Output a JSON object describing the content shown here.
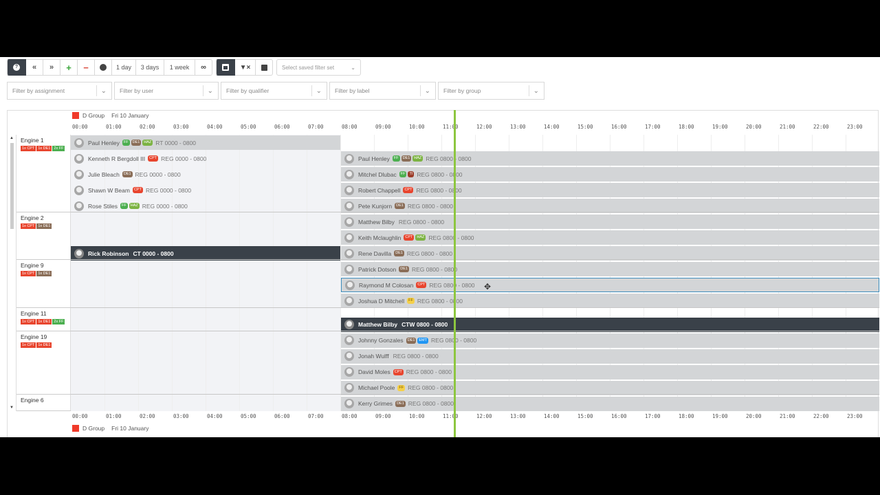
{
  "toolbar": {
    "day1": "1 day",
    "day3": "3 days",
    "week1": "1 week",
    "saved_filter_placeholder": "Select saved filter set"
  },
  "filters": [
    {
      "label": "Filter by assignment"
    },
    {
      "label": "Filter by user"
    },
    {
      "label": "Filter by qualifier"
    },
    {
      "label": "Filter by label"
    },
    {
      "label": "Filter by group"
    }
  ],
  "header": {
    "group": "D Group",
    "date": "Fri 10 January"
  },
  "hours": [
    "00:00",
    "01:00",
    "02:00",
    "03:00",
    "04:00",
    "05:00",
    "06:00",
    "07:00",
    "08:00",
    "09:00",
    "10:00",
    "11:00",
    "12:00",
    "13:00",
    "14:00",
    "15:00",
    "16:00",
    "17:00",
    "18:00",
    "19:00",
    "20:00",
    "21:00",
    "22:00",
    "23:00"
  ],
  "colors": {
    "now_line": "#8dc63f",
    "group": "#f03a2a",
    "dark_row": "#3a4149",
    "grey_row": "#d3d5d7"
  },
  "engines": [
    {
      "name": "Engine 1",
      "badges": [
        {
          "t": "1x CPT",
          "c": "#e8452e"
        },
        {
          "t": "1x DE1",
          "c": "#e8452e"
        },
        {
          "t": "2x FF",
          "c": "#4caf50"
        }
      ]
    },
    {
      "name": "Engine 2",
      "badges": [
        {
          "t": "1x CPT",
          "c": "#e8452e"
        },
        {
          "t": "1x DE1",
          "c": "#8a6d57"
        }
      ]
    },
    {
      "name": "Engine 9",
      "badges": [
        {
          "t": "1x CPT",
          "c": "#e8452e"
        },
        {
          "t": "1x DE1",
          "c": "#8a6d57"
        }
      ]
    },
    {
      "name": "Engine 11",
      "badges": [
        {
          "t": "1x CPT",
          "c": "#e8452e"
        },
        {
          "t": "1x DE1",
          "c": "#e8452e"
        },
        {
          "t": "2x FF",
          "c": "#4caf50"
        }
      ]
    },
    {
      "name": "Engine 19",
      "badges": [
        {
          "t": "1x CPT",
          "c": "#e8452e"
        },
        {
          "t": "1x DE1",
          "c": "#e8452e"
        }
      ]
    },
    {
      "name": "Engine 6",
      "badges": []
    }
  ],
  "shifts": [
    {
      "name": "Paul Henley",
      "badges": [
        {
          "t": "FF",
          "c": "#4caf50"
        },
        {
          "t": "DE1",
          "c": "#8a6d57"
        },
        {
          "t": "HAZ",
          "c": "#7cb342"
        }
      ],
      "shift": "RT 0000 - 0800",
      "side": "left",
      "kind": "grey"
    },
    {
      "name": "Kenneth R Bergdoll III",
      "badges": [
        {
          "t": "CPT",
          "c": "#e8452e"
        }
      ],
      "shift": "REG 0000 - 0800",
      "side": "left",
      "kind": "none"
    },
    {
      "name": "Julie Bleach",
      "badges": [
        {
          "t": "DE1",
          "c": "#8a6d57"
        }
      ],
      "shift": "REG 0000 - 0800",
      "side": "left",
      "kind": "none"
    },
    {
      "name": "Shawn W Beam",
      "badges": [
        {
          "t": "CPT",
          "c": "#e8452e"
        }
      ],
      "shift": "REG 0000 - 0800",
      "side": "left",
      "kind": "none"
    },
    {
      "name": "Rose Stiles",
      "badges": [
        {
          "t": "FF",
          "c": "#4caf50"
        },
        {
          "t": "HAZ",
          "c": "#7cb342"
        }
      ],
      "shift": "REG 0000 - 0800",
      "side": "left",
      "kind": "none"
    },
    {
      "name": "Paul Henley",
      "badges": [
        {
          "t": "FF",
          "c": "#4caf50"
        },
        {
          "t": "DE1",
          "c": "#8a6d57"
        },
        {
          "t": "HAZ",
          "c": "#7cb342"
        }
      ],
      "shift": "REG 0800 - 0800",
      "side": "right",
      "kind": "grey"
    },
    {
      "name": "Mitchel Dlubac",
      "badges": [
        {
          "t": "FF",
          "c": "#4caf50"
        },
        {
          "t": "TI",
          "c": "#9c3d2a"
        }
      ],
      "shift": "REG 0800 - 0800",
      "side": "right",
      "kind": "grey"
    },
    {
      "name": "Robert Chappell",
      "badges": [
        {
          "t": "CPT",
          "c": "#e8452e"
        }
      ],
      "shift": "REG 0800 - 0800",
      "side": "right",
      "kind": "grey"
    },
    {
      "name": "Pete Kunjorn",
      "badges": [
        {
          "t": "DE1",
          "c": "#8a6d57"
        }
      ],
      "shift": "REG 0800 - 0800",
      "side": "right",
      "kind": "grey"
    },
    {
      "name": "Matthew Bilby",
      "badges": [],
      "shift": "REG 0800 - 0800",
      "side": "right",
      "kind": "grey"
    },
    {
      "name": "Keith Mclaughlin",
      "badges": [
        {
          "t": "CPT",
          "c": "#e8452e"
        },
        {
          "t": "HAZ",
          "c": "#7cb342"
        }
      ],
      "shift": "REG 0800 - 0800",
      "side": "right",
      "kind": "grey"
    },
    {
      "name": "Rick Robinson",
      "badges": [],
      "shift": "CT 0000 - 0800",
      "side": "left",
      "kind": "dark"
    },
    {
      "name": "Rene Davilla",
      "badges": [
        {
          "t": "DE1",
          "c": "#8a6d57"
        }
      ],
      "shift": "REG 0800 - 0800",
      "side": "right",
      "kind": "grey"
    },
    {
      "name": "Patrick Dotson",
      "badges": [
        {
          "t": "DE1",
          "c": "#8a6d57"
        }
      ],
      "shift": "REG 0800 - 0800",
      "side": "right",
      "kind": "grey"
    },
    {
      "name": "Raymond M Colosan",
      "badges": [
        {
          "t": "CPT",
          "c": "#e8452e"
        }
      ],
      "shift": "REG 0800 - 0800",
      "side": "right",
      "kind": "sel"
    },
    {
      "name": "Joshua D Mitchell",
      "badges": [
        {
          "t": "FF",
          "c": "#f5d04a"
        }
      ],
      "shift": "REG 0800 - 0800",
      "side": "right",
      "kind": "grey"
    },
    {
      "name": "Matthew Bilby",
      "badges": [],
      "shift": "CTW 0800 - 0800",
      "side": "right",
      "kind": "dark"
    },
    {
      "name": "Johnny Gonzales",
      "badges": [
        {
          "t": "DE1",
          "c": "#8a6d57"
        },
        {
          "t": "EMT",
          "c": "#2196f3"
        }
      ],
      "shift": "REG 0800 - 0800",
      "side": "right",
      "kind": "grey"
    },
    {
      "name": "Jonah Wulff",
      "badges": [],
      "shift": "REG 0800 - 0800",
      "side": "right",
      "kind": "grey"
    },
    {
      "name": "David Moles",
      "badges": [
        {
          "t": "CPT",
          "c": "#e8452e"
        }
      ],
      "shift": "REG 0800 - 0800",
      "side": "right",
      "kind": "grey"
    },
    {
      "name": "Michael Poole",
      "badges": [
        {
          "t": "FF",
          "c": "#f5d04a"
        }
      ],
      "shift": "REG 0800 - 0800",
      "side": "right",
      "kind": "grey"
    },
    {
      "name": "Kerry Grimes",
      "badges": [
        {
          "t": "DE1",
          "c": "#8a6d57"
        }
      ],
      "shift": "REG 0800 - 0800",
      "side": "right",
      "kind": "grey"
    }
  ]
}
